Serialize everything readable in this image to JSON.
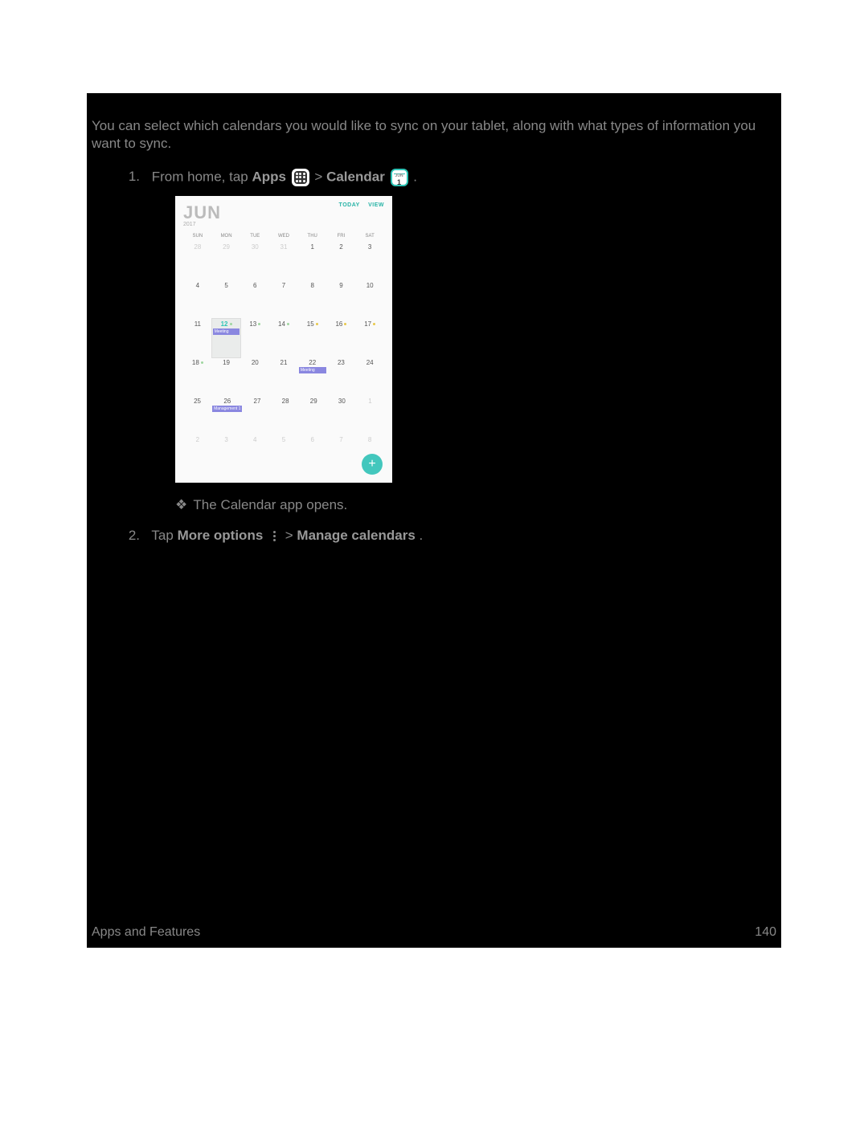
{
  "intro": "You can select which calendars you would like to sync on your tablet, along with what types of information you want to sync.",
  "step1": {
    "num": "1.",
    "pre": "From home, tap ",
    "apps": "Apps",
    "sep": " > ",
    "calendar": "Calendar",
    "post": "."
  },
  "cal_icon": {
    "label": "JUN",
    "num": "1"
  },
  "calshot": {
    "month": "JUN",
    "year": "2017",
    "btn_today": "TODAY",
    "btn_view": "VIEW",
    "dow": [
      "SUN",
      "MON",
      "TUE",
      "WED",
      "THU",
      "FRI",
      "SAT"
    ],
    "weeks": [
      [
        {
          "n": "28",
          "faded": true
        },
        {
          "n": "29",
          "faded": true
        },
        {
          "n": "30",
          "faded": true
        },
        {
          "n": "31",
          "faded": true
        },
        {
          "n": "1"
        },
        {
          "n": "2"
        },
        {
          "n": "3"
        }
      ],
      [
        {
          "n": "4"
        },
        {
          "n": "5"
        },
        {
          "n": "6"
        },
        {
          "n": "7"
        },
        {
          "n": "8"
        },
        {
          "n": "9"
        },
        {
          "n": "10"
        }
      ],
      [
        {
          "n": "11"
        },
        {
          "n": "12",
          "today": true,
          "dot": "g",
          "event": "Meeting"
        },
        {
          "n": "13",
          "dot": "g"
        },
        {
          "n": "14",
          "dot": "g"
        },
        {
          "n": "15",
          "dot": "y"
        },
        {
          "n": "16",
          "dot": "y"
        },
        {
          "n": "17",
          "dot": "y"
        }
      ],
      [
        {
          "n": "18",
          "dot": "g"
        },
        {
          "n": "19"
        },
        {
          "n": "20"
        },
        {
          "n": "21"
        },
        {
          "n": "22",
          "event": "Meeting"
        },
        {
          "n": "23"
        },
        {
          "n": "24"
        }
      ],
      [
        {
          "n": "25"
        },
        {
          "n": "26",
          "event": "Management 1"
        },
        {
          "n": "27"
        },
        {
          "n": "28"
        },
        {
          "n": "29"
        },
        {
          "n": "30"
        },
        {
          "n": "1",
          "faded": true
        }
      ],
      [
        {
          "n": "2",
          "faded": true
        },
        {
          "n": "3",
          "faded": true
        },
        {
          "n": "4",
          "faded": true
        },
        {
          "n": "5",
          "faded": true
        },
        {
          "n": "6",
          "faded": true
        },
        {
          "n": "7",
          "faded": true
        },
        {
          "n": "8",
          "faded": true
        }
      ]
    ],
    "fab": "+"
  },
  "result": {
    "sym": "❖",
    "text": "The Calendar app opens."
  },
  "step2": {
    "num": "2.",
    "pre": "Tap ",
    "more": "More options",
    "sep": " > ",
    "manage": "Manage calendars",
    "post": "."
  },
  "footer": {
    "section": "Apps and Features",
    "page": "140"
  }
}
